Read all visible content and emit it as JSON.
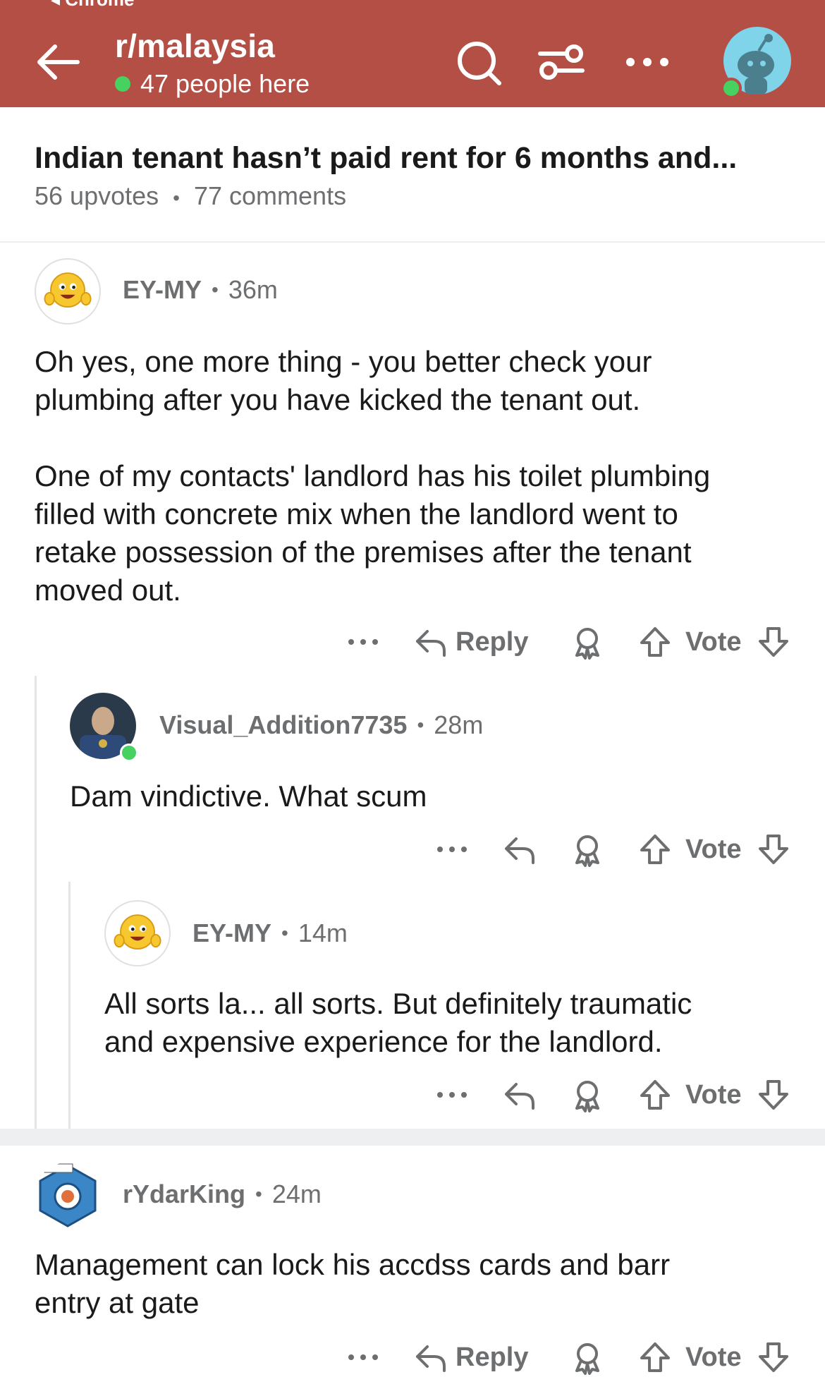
{
  "status_bar": {
    "back_app": "◂ Chrome"
  },
  "header": {
    "subreddit": "r/malaysia",
    "online_text": "47 people here",
    "icons": [
      "back-arrow-icon",
      "search-icon",
      "filter-icon",
      "more-icon",
      "user-avatar"
    ],
    "colors": {
      "background": "#b44f45",
      "online": "#46d160"
    }
  },
  "post": {
    "title": "Indian tenant hasn’t paid rent for 6 months and...",
    "upvotes": "56 upvotes",
    "comments": "77 comments",
    "separator": "•"
  },
  "comments": [
    {
      "author": "EY-MY",
      "age": "36m",
      "body": "Oh yes, one more thing - you better check your\nplumbing after you have kicked the tenant out.\n\nOne of my contacts' landlord has his toilet plumbing\nfilled with concrete mix when the landlord went to\nretake possession of the premises after the tenant\nmoved out.",
      "reply_label": "Reply",
      "vote_label": "Vote"
    },
    {
      "author": "Visual_Addition7735",
      "age": "28m",
      "body": "Dam vindictive. What scum",
      "vote_label": "Vote"
    },
    {
      "author": "EY-MY",
      "age": "14m",
      "body": "All sorts la... all sorts. But definitely traumatic\nand expensive experience for the landlord.",
      "vote_label": "Vote"
    },
    {
      "author": "rYdarKing",
      "age": "24m",
      "body": "Management can lock his accdss cards and  barr\nentry at gate",
      "reply_label": "Reply",
      "vote_label": "Vote"
    }
  ],
  "sep": "•"
}
